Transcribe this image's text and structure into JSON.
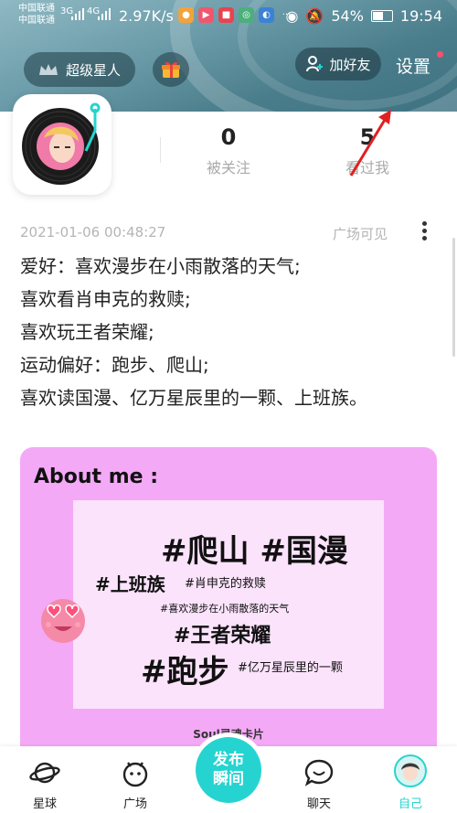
{
  "status_bar": {
    "carrier1": "中国联通",
    "carrier2": "中国联通",
    "net1": "3G",
    "net2": "4G",
    "speed": "2.97K/s",
    "battery": "54%",
    "time": "19:54"
  },
  "header": {
    "vip_label": "超级星人",
    "add_friend_label": "加好友",
    "settings_label": "设置"
  },
  "profile": {
    "followers_count": "0",
    "followers_label": "被关注",
    "viewers_count": "5",
    "viewers_label": "看过我"
  },
  "post": {
    "timestamp": "2021-01-06 00:48:27",
    "visibility": "广场可见",
    "lines": [
      "爱好：喜欢漫步在小雨散落的天气;",
      "喜欢看肖申克的救赎;",
      "喜欢玩王者荣耀;",
      "运动偏好：跑步、爬山;",
      "喜欢读国漫、亿万星辰里的一颗、上班族。"
    ]
  },
  "card": {
    "title": "About me :",
    "tags": {
      "t1": "#爬山 #国漫",
      "t2": "#上班族",
      "t3": "#肖申克的救赎",
      "t4": "#喜欢漫步在小雨散落的天气",
      "t5": "#王者荣耀",
      "t6": "#跑步",
      "t7": "#亿万星辰里的一颗"
    },
    "footer": "Soul灵魂卡片"
  },
  "nav": {
    "planet": "星球",
    "square": "广场",
    "publish_line1": "发布",
    "publish_line2": "瞬间",
    "chat": "聊天",
    "me": "自己"
  },
  "colors": {
    "accent": "#25d4d0",
    "card_bg": "#f4a9f6",
    "card_inner": "#fbe3fb",
    "header": "#5f92a0",
    "annotation_arrow": "#e02020"
  },
  "icons": [
    "crown-icon",
    "gift-icon",
    "add-person-icon",
    "vinyl-avatar",
    "more-vertical-icon",
    "heart-eyes-emoji",
    "planet-icon",
    "square-icon",
    "chat-icon",
    "profile-avatar"
  ]
}
